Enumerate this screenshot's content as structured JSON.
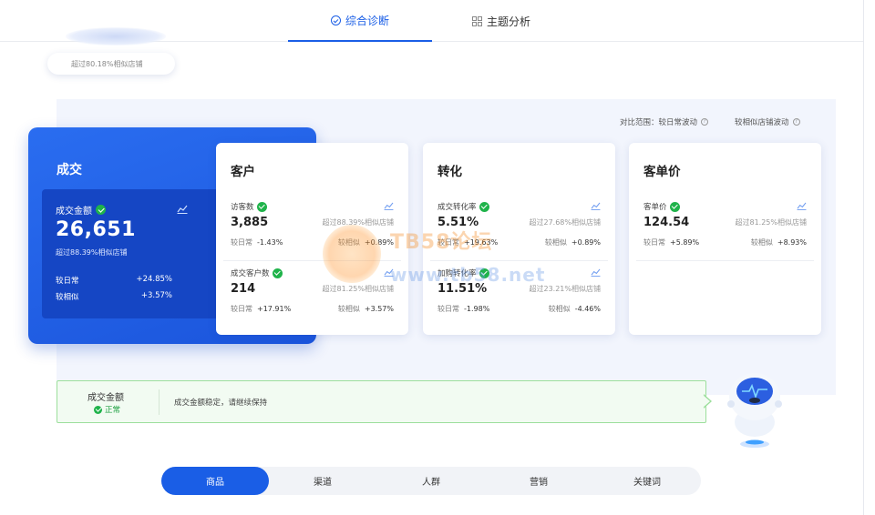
{
  "top_tabs": [
    {
      "label": "综合诊断",
      "icon": "diagnosis-icon",
      "active": true
    },
    {
      "label": "主题分析",
      "icon": "grid-icon",
      "active": false
    }
  ],
  "score": {
    "text": "超过80.18%相似店铺"
  },
  "compare_range": {
    "label": "对比范围：较日常波动",
    "similar_label": "较相似店铺波动"
  },
  "deal": {
    "title": "成交",
    "metric_label": "成交金额",
    "value": "26,651",
    "sub": "超过88.39%相似店铺",
    "day_label": "较日常",
    "day_value": "+24.85%",
    "sim_label": "较相似",
    "sim_value": "+3.57%"
  },
  "cards": [
    {
      "title": "客户",
      "metrics": [
        {
          "label": "访客数",
          "value": "3,885",
          "pct": "超过88.39%相似店铺",
          "day_label": "较日常",
          "day": "-1.43%",
          "sim_label": "较相似",
          "sim": "+0.89%"
        },
        {
          "label": "成交客户数",
          "value": "214",
          "pct": "超过81.25%相似店铺",
          "day_label": "较日常",
          "day": "+17.91%",
          "sim_label": "较相似",
          "sim": "+3.57%"
        }
      ]
    },
    {
      "title": "转化",
      "metrics": [
        {
          "label": "成交转化率",
          "value": "5.51%",
          "pct": "超过27.68%相似店铺",
          "day_label": "较日常",
          "day": "+19.63%",
          "sim_label": "较相似",
          "sim": "+0.89%"
        },
        {
          "label": "加购转化率",
          "value": "11.51%",
          "pct": "超过23.21%相似店铺",
          "day_label": "较日常",
          "day": "-1.98%",
          "sim_label": "较相似",
          "sim": "-4.46%"
        }
      ]
    },
    {
      "title": "客单价",
      "metrics": [
        {
          "label": "客单价",
          "value": "124.54",
          "pct": "超过81.25%相似店铺",
          "day_label": "较日常",
          "day": "+5.89%",
          "sim_label": "较相似",
          "sim": "+8.93%"
        }
      ]
    }
  ],
  "status": {
    "title": "成交金额",
    "state": "正常",
    "message": "成交金额稳定，请继续保持",
    "color": "#1fa042"
  },
  "watermark": {
    "title": "TB58论坛",
    "url": "www.tb58.net"
  },
  "bottom_tabs": [
    {
      "label": "商品",
      "active": true
    },
    {
      "label": "渠道",
      "active": false
    },
    {
      "label": "人群",
      "active": false
    },
    {
      "label": "营销",
      "active": false
    },
    {
      "label": "关键词",
      "active": false
    }
  ],
  "colors": {
    "accent": "#1a5ee6",
    "success": "#1fb34a",
    "panel": "#f2f5fd"
  }
}
